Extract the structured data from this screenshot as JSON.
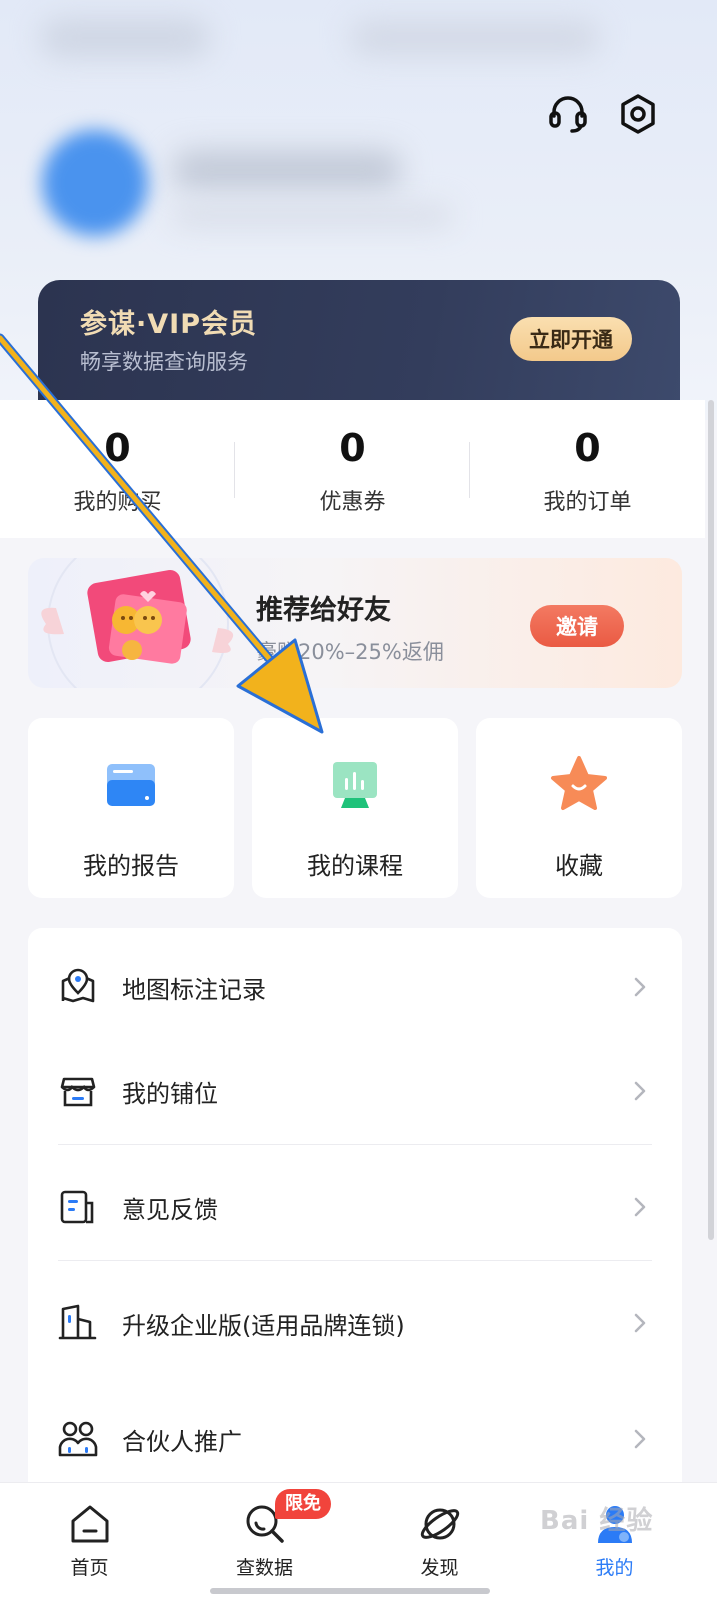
{
  "vip": {
    "title": "参谋·VIP会员",
    "subtitle": "畅享数据查询服务",
    "button": "立即开通"
  },
  "stats": [
    {
      "value": "0",
      "label": "我的购买"
    },
    {
      "value": "0",
      "label": "优惠券"
    },
    {
      "value": "0",
      "label": "我的订单"
    }
  ],
  "invite": {
    "title": "推荐给好友",
    "subtitle": "豪赚20%–25%返佣",
    "button": "邀请"
  },
  "tiles": [
    {
      "label": "我的报告",
      "icon": "report-folder-icon"
    },
    {
      "label": "我的课程",
      "icon": "course-screen-icon"
    },
    {
      "label": "收藏",
      "icon": "star-icon"
    }
  ],
  "menu": [
    {
      "label": "地图标注记录",
      "icon": "map-pin-icon"
    },
    {
      "label": "我的铺位",
      "icon": "store-icon"
    },
    {
      "label": "意见反馈",
      "icon": "feedback-icon"
    },
    {
      "label": "升级企业版(适用品牌连锁)",
      "icon": "building-icon"
    },
    {
      "label": "合伙人推广",
      "icon": "partners-icon"
    }
  ],
  "tabbar": {
    "items": [
      {
        "label": "首页",
        "icon": "home-icon"
      },
      {
        "label": "查数据",
        "icon": "search-data-icon",
        "badge": "限免"
      },
      {
        "label": "发现",
        "icon": "planet-icon"
      },
      {
        "label": "我的",
        "icon": "user-icon",
        "active": true
      }
    ]
  },
  "watermark": "Bai 经验",
  "colors": {
    "accent": "#2b7bf6",
    "vip_gold": "#f1dcb4",
    "invite_red": "#ea5a43",
    "badge_red": "#f1443c",
    "annotation_arrow": "#f2b21c"
  }
}
